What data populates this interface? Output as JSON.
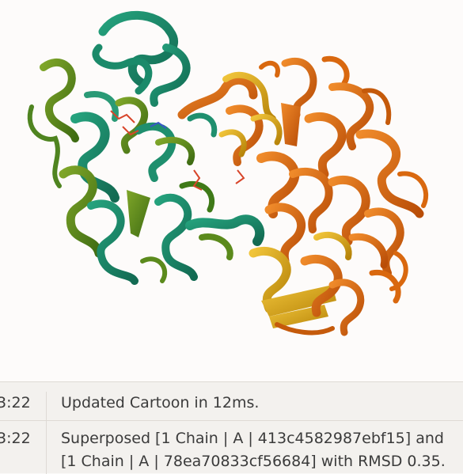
{
  "viewer": {
    "content": "protein structure cartoon (superposed chains)"
  },
  "log": {
    "entries": [
      {
        "time": "3:22",
        "message": "Updated Cartoon in 12ms."
      },
      {
        "time": "3:22",
        "message": "Superposed [1 Chain | A | 413c4582987ebf15] and [1 Chain | A | 78ea70833cf56684] with RMSD 0.35."
      }
    ]
  },
  "colors": {
    "chain_1_primary": "#1f8f6e",
    "chain_1_secondary": "#5b8a1c",
    "chain_2_primary": "#d9680f",
    "chain_2_secondary": "#d5a316",
    "ligand": "#d8452a"
  }
}
